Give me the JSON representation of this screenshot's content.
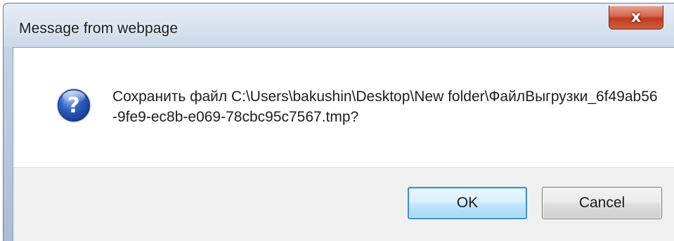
{
  "window": {
    "title": "Message from webpage",
    "close_glyph": "x"
  },
  "dialog": {
    "icon": "question-icon",
    "icon_glyph": "?",
    "message": "Сохранить файл C:\\Users\\bakushin\\Desktop\\New folder\\ФайлВыгрузки_6f49ab56-9fe9-ec8b-e069-78cbc95c7567.tmp?"
  },
  "buttons": {
    "ok_label": "OK",
    "cancel_label": "Cancel"
  },
  "colors": {
    "accent": "#3c8fd0",
    "close": "#c23a1f",
    "icon_blue": "#1f4fa3"
  }
}
